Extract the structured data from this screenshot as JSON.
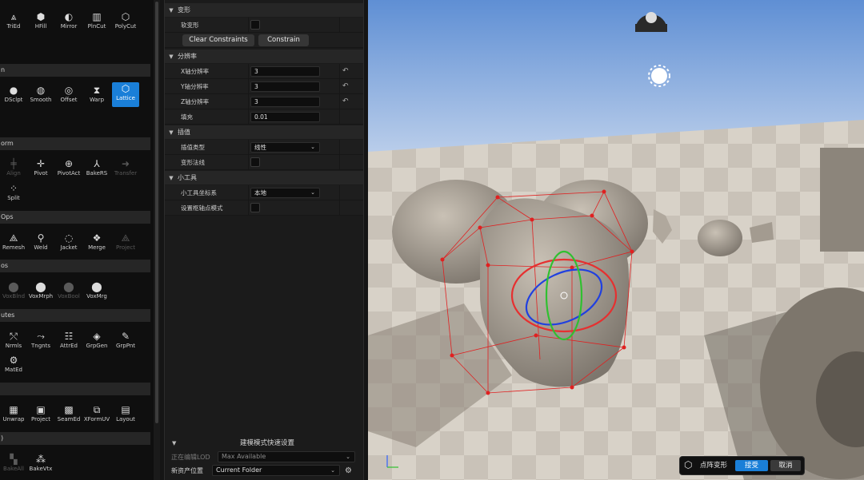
{
  "palette": {
    "sections": [
      {
        "label": "n",
        "top": 0
      },
      {
        "label": "orm"
      },
      {
        "label": "Ops"
      },
      {
        "label": "os"
      },
      {
        "label": "utes"
      },
      {
        "label": ""
      },
      {
        "label": ")"
      }
    ],
    "row_top": [
      {
        "label": "TriEd",
        "icon": "tri-edit-icon"
      },
      {
        "label": "HFill",
        "icon": "hole-fill-icon"
      },
      {
        "label": "Mirror",
        "icon": "mirror-icon"
      },
      {
        "label": "PlnCut",
        "icon": "plane-cut-icon"
      },
      {
        "label": "PolyCut",
        "icon": "poly-cut-icon"
      }
    ],
    "row_deform": [
      {
        "label": "DSclpt",
        "icon": "dynamic-sculpt-icon"
      },
      {
        "label": "Smooth",
        "icon": "smooth-icon"
      },
      {
        "label": "Offset",
        "icon": "offset-icon"
      },
      {
        "label": "Warp",
        "icon": "warp-icon"
      },
      {
        "label": "Lattice",
        "icon": "lattice-icon",
        "selected": true
      }
    ],
    "row_transform": [
      {
        "label": "Align",
        "icon": "align-icon",
        "disabled": true
      },
      {
        "label": "Pivot",
        "icon": "pivot-icon"
      },
      {
        "label": "PivotAct",
        "icon": "pivot-actor-icon"
      },
      {
        "label": "BakeRS",
        "icon": "bake-rs-icon"
      },
      {
        "label": "Transfer",
        "icon": "transfer-icon",
        "disabled": true
      }
    ],
    "row_transform2": [
      {
        "label": "Split",
        "icon": "split-icon"
      }
    ],
    "row_meshops": [
      {
        "label": "Remesh",
        "icon": "remesh-icon"
      },
      {
        "label": "Weld",
        "icon": "weld-icon"
      },
      {
        "label": "Jacket",
        "icon": "jacket-icon"
      },
      {
        "label": "Merge",
        "icon": "merge-icon"
      },
      {
        "label": "Project",
        "icon": "project-icon",
        "disabled": true
      }
    ],
    "row_voxel": [
      {
        "label": "VoxBlnd",
        "icon": "voxel-blend-icon",
        "disabled": true
      },
      {
        "label": "VoxMrph",
        "icon": "voxel-morph-icon"
      },
      {
        "label": "VoxBool",
        "icon": "voxel-bool-icon",
        "disabled": true
      },
      {
        "label": "VoxMrg",
        "icon": "voxel-merge-icon"
      }
    ],
    "row_attr": [
      {
        "label": "Nrmls",
        "icon": "normals-icon"
      },
      {
        "label": "Tngnts",
        "icon": "tangents-icon"
      },
      {
        "label": "AttrEd",
        "icon": "attribute-edit-icon"
      },
      {
        "label": "GrpGen",
        "icon": "group-gen-icon"
      },
      {
        "label": "GrpPnt",
        "icon": "group-paint-icon"
      }
    ],
    "row_attr2": [
      {
        "label": "MatEd",
        "icon": "material-edit-icon"
      }
    ],
    "row_uv": [
      {
        "label": "Unwrap",
        "icon": "unwrap-icon"
      },
      {
        "label": "Project",
        "icon": "uv-project-icon"
      },
      {
        "label": "SeamEd",
        "icon": "seam-edit-icon"
      },
      {
        "label": "XFormUV",
        "icon": "transform-uv-icon"
      },
      {
        "label": "Layout",
        "icon": "uv-layout-icon"
      }
    ],
    "row_bake": [
      {
        "label": "BakeAll",
        "icon": "bake-all-icon",
        "disabled": true
      },
      {
        "label": "BakeVtx",
        "icon": "bake-vertex-icon"
      }
    ]
  },
  "details": {
    "cat_deform": "变形",
    "soft_deform_label": "软变形",
    "clear_constraints": "Clear Constraints",
    "constrain": "Constrain",
    "cat_resolution": "分辨率",
    "x_res_label": "X轴分辨率",
    "x_res_value": "3",
    "y_res_label": "Y轴分辨率",
    "y_res_value": "3",
    "z_res_label": "Z轴分辨率",
    "z_res_value": "3",
    "padding_label": "填充",
    "padding_value": "0.01",
    "cat_interp": "插值",
    "interp_type_label": "插值类型",
    "interp_type_value": "线性",
    "deform_normals_label": "变形法线",
    "cat_gizmo": "小工具",
    "gizmo_coord_label": "小工具坐标系",
    "gizmo_coord_value": "本地",
    "pivot_mode_label": "设置枢轴点模式"
  },
  "quick_settings": {
    "title": "建模模式快速设置",
    "lod_label": "正在编辑LOD",
    "lod_value": "Max Available",
    "asset_loc_label": "新资产位置",
    "asset_loc_value": "Current Folder"
  },
  "viewport": {
    "toast_label": "点阵变形",
    "accept": "接受",
    "cancel": "取消"
  },
  "colors": {
    "accent": "#1a7fd8",
    "lattice": "#e02020",
    "sky": "#8fb2e0"
  }
}
